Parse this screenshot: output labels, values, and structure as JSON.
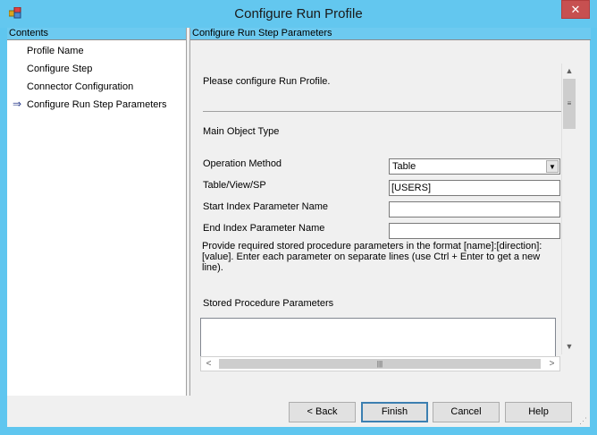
{
  "window": {
    "title": "Configure Run Profile",
    "close_glyph": "✕"
  },
  "left_pane": {
    "header": "Contents",
    "items": [
      {
        "label": "Profile Name",
        "current": false
      },
      {
        "label": "Configure Step",
        "current": false
      },
      {
        "label": "Connector Configuration",
        "current": false
      },
      {
        "label": "Configure Run Step Parameters",
        "current": true
      }
    ],
    "current_marker": "⇒"
  },
  "right_pane": {
    "header": "Configure Run Step Parameters",
    "intro": "Please configure Run Profile.",
    "main_object_type_label": "Main Object Type",
    "operation_method": {
      "label": "Operation Method",
      "value": "Table"
    },
    "table_view_sp": {
      "label": "Table/View/SP",
      "value": "[USERS]"
    },
    "start_index": {
      "label": "Start Index Parameter Name",
      "value": ""
    },
    "end_index": {
      "label": "End Index Parameter Name",
      "value": ""
    },
    "description": "Provide required stored procedure parameters in the format [name]:[direction]:[value]. Enter each parameter on separate lines (use Ctrl + Enter to get a new line).",
    "stored_procedure": {
      "label": "Stored  Procedure Parameters",
      "value": ""
    }
  },
  "buttons": {
    "back": "< Back",
    "finish": "Finish",
    "cancel": "Cancel",
    "help": "Help"
  }
}
